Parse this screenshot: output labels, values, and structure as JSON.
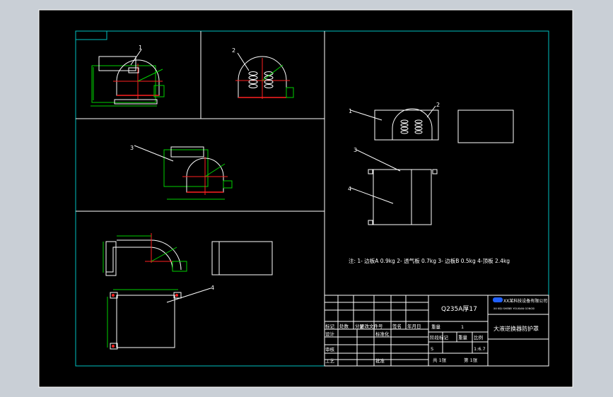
{
  "colors": {
    "outer_bg": "#c9cfd6",
    "sheet_bg": "#000000",
    "frame": "#ffffff",
    "border_cyan": "#00bfbf",
    "green": "#00d000",
    "red": "#ff2020",
    "yellow": "#e8e800",
    "white": "#ffffff"
  },
  "callouts": {
    "v1_part": "1",
    "v2_part": "2",
    "v3_part": "3",
    "v4_part": "4",
    "iso_1": "1",
    "iso_2": "2",
    "iso_3": "3",
    "iso_4": "4"
  },
  "note": "注: 1- 边板A 0.9kg 2- 透气板 0.7kg 3- 边板B 0.5kg 4-顶板 2.4kg",
  "title_block": {
    "material": "Q235A厚17",
    "company": "XX某科技设备有限公司",
    "company_sub": "XX KEJI SHEBEI YOUXIAN GONGSI",
    "drawing_title": "大液逆换器防护罩",
    "rev_headers": [
      "标记",
      "处数",
      "分区",
      "更改文件号",
      "签名",
      "年月日"
    ],
    "design": "设计",
    "standardize": "标准化",
    "review": "审核",
    "process": "工艺",
    "approve": "批准",
    "weight_label": "重量",
    "weight_value": "1",
    "stage_mark": "阶段标记",
    "weight2": "重量",
    "scale": "比例",
    "s_mark": "S",
    "scale_value": "1:6.7",
    "sheets_total": "共 1张",
    "sheet_no": "第 1张"
  }
}
